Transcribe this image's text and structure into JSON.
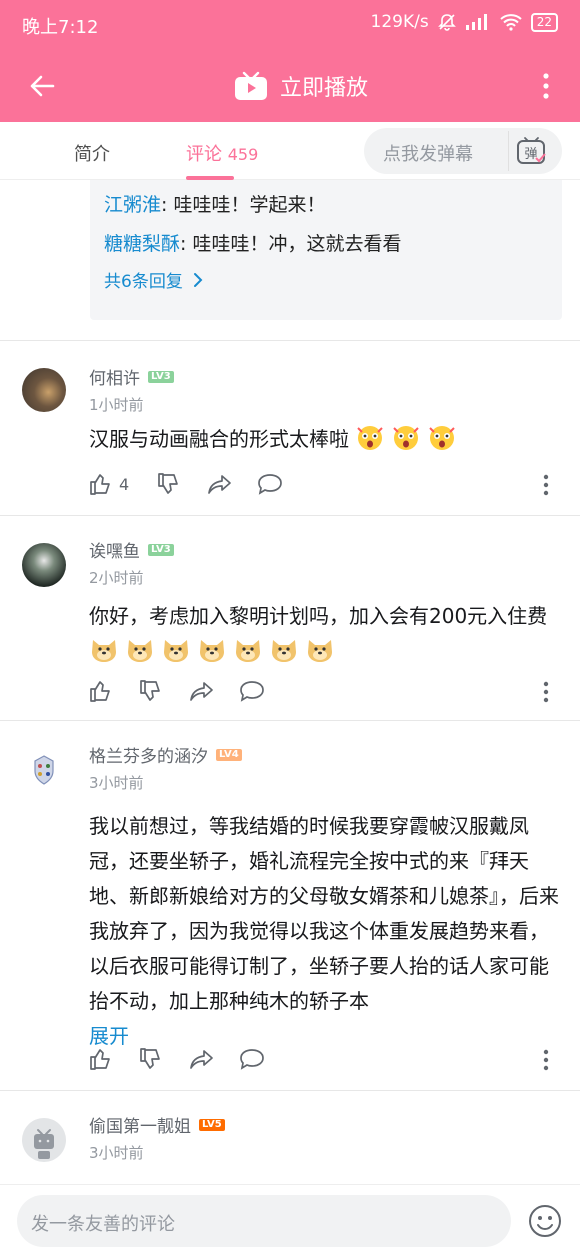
{
  "status_bar": {
    "time": "晚上7:12",
    "speed": "129K/s",
    "battery": "22"
  },
  "app_bar": {
    "title": "立即播放"
  },
  "tabs": {
    "intro": "简介",
    "comments": "评论",
    "comments_count": "459",
    "danmaku_placeholder": "点我发弹幕",
    "danmaku_icon_text": "弹"
  },
  "reply_box": {
    "replies": [
      {
        "user": "江粥淮",
        "text": ": 哇哇哇！学起来！"
      },
      {
        "user": "糖糖梨酥",
        "text": ": 哇哇哇！冲，这就去看看"
      }
    ],
    "more": "共6条回复"
  },
  "comments": [
    {
      "username": "何相许",
      "level": "LV3",
      "time": "1小时前",
      "text": "汉服与动画融合的形式太棒啦",
      "likes": "4"
    },
    {
      "username": "诶嘿鱼",
      "level": "LV3",
      "time": "2小时前",
      "text": "你好，考虑加入黎明计划吗，加入会有200元入住费"
    },
    {
      "username": "格兰芬多的涵汐",
      "level": "LV4",
      "time": "3小时前",
      "text": "我以前想过，等我结婚的时候我要穿霞帔汉服戴凤冠，还要坐轿子，婚礼流程完全按中式的来『拜天地、新郎新娘给对方的父母敬女婿茶和儿媳茶』，后来我放弃了，因为我觉得以我这个体重发展趋势来看，以后衣服可能得订制了，坐轿子要人抬的话人家可能抬不动，加上那种纯木的轿子本",
      "expand": "展开"
    },
    {
      "username": "偷国第一靓姐",
      "level": "LV5",
      "time": "3小时前"
    }
  ],
  "bottom_bar": {
    "placeholder": "发一条友善的评论"
  },
  "colors": {
    "brand_pink": "#fb7299",
    "link_blue": "#178bcf"
  }
}
